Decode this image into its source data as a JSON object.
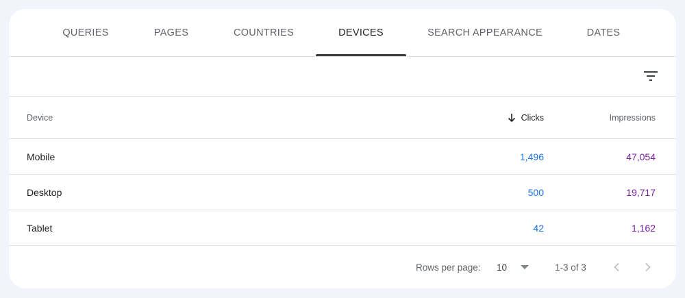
{
  "tabs": [
    {
      "label": "QUERIES"
    },
    {
      "label": "PAGES"
    },
    {
      "label": "COUNTRIES"
    },
    {
      "label": "DEVICES"
    },
    {
      "label": "SEARCH APPEARANCE"
    },
    {
      "label": "DATES"
    }
  ],
  "active_tab": "DEVICES",
  "filter": {
    "icon": "filter-icon"
  },
  "table": {
    "columns": {
      "device": "Device",
      "clicks": "Clicks",
      "impressions": "Impressions"
    },
    "sorted_by": "Clicks",
    "sort_direction": "descending",
    "rows": [
      {
        "device": "Mobile",
        "clicks": "1,496",
        "impressions": "47,054"
      },
      {
        "device": "Desktop",
        "clicks": "500",
        "impressions": "19,717"
      },
      {
        "device": "Tablet",
        "clicks": "42",
        "impressions": "1,162"
      }
    ]
  },
  "pagination": {
    "rows_per_page_label": "Rows per page:",
    "rows_per_page_value": "10",
    "range": "1-3 of 3"
  },
  "colors": {
    "clicks": "#1a73e8",
    "impressions": "#7b1fa2",
    "active_tab_underline": "#3c4043"
  }
}
